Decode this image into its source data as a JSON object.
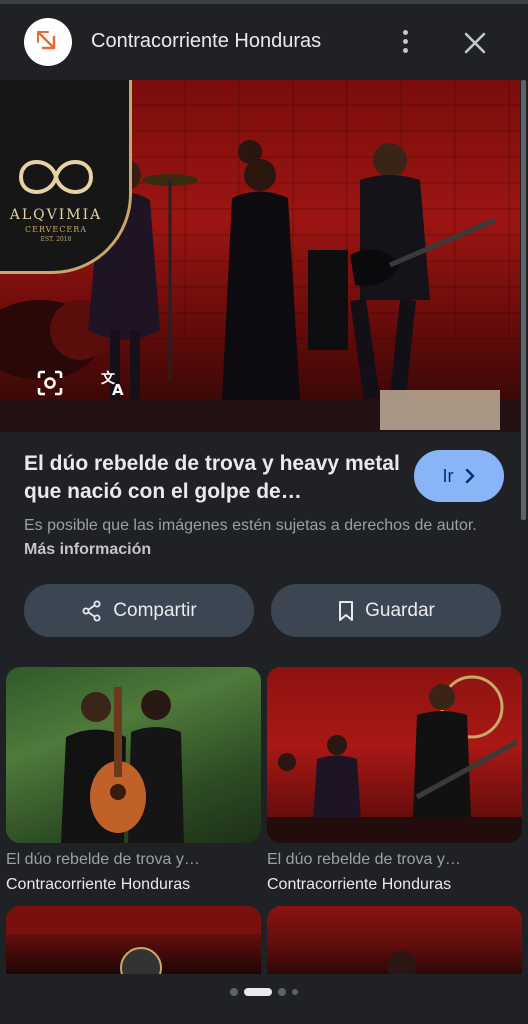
{
  "header": {
    "site_name": "Contracorriente Honduras",
    "more_icon": "more-vert-icon",
    "close_icon": "close-icon"
  },
  "hero": {
    "brand_name": "ALQVIMIA",
    "brand_sub": "CERVECERA",
    "brand_est": "EST. 2018",
    "lens_icon": "lens-search-icon",
    "translate_icon": "translate-icon"
  },
  "result": {
    "title": "El dúo rebelde de trova y heavy metal que nació con el golpe de…",
    "go_label": "Ir",
    "disclaimer": "Es posible que las imágenes estén sujetas a derechos de autor.",
    "more_info": "Más información"
  },
  "actions": {
    "share_label": "Compartir",
    "save_label": "Guardar"
  },
  "related": [
    {
      "title": "El dúo rebelde de trova y…",
      "source": "Contracorriente Honduras"
    },
    {
      "title": "El dúo rebelde de trova y…",
      "source": "Contracorriente Honduras"
    }
  ],
  "colors": {
    "background": "#202124",
    "accent_button": "#8ab4f8",
    "action_button": "#3c4652"
  }
}
